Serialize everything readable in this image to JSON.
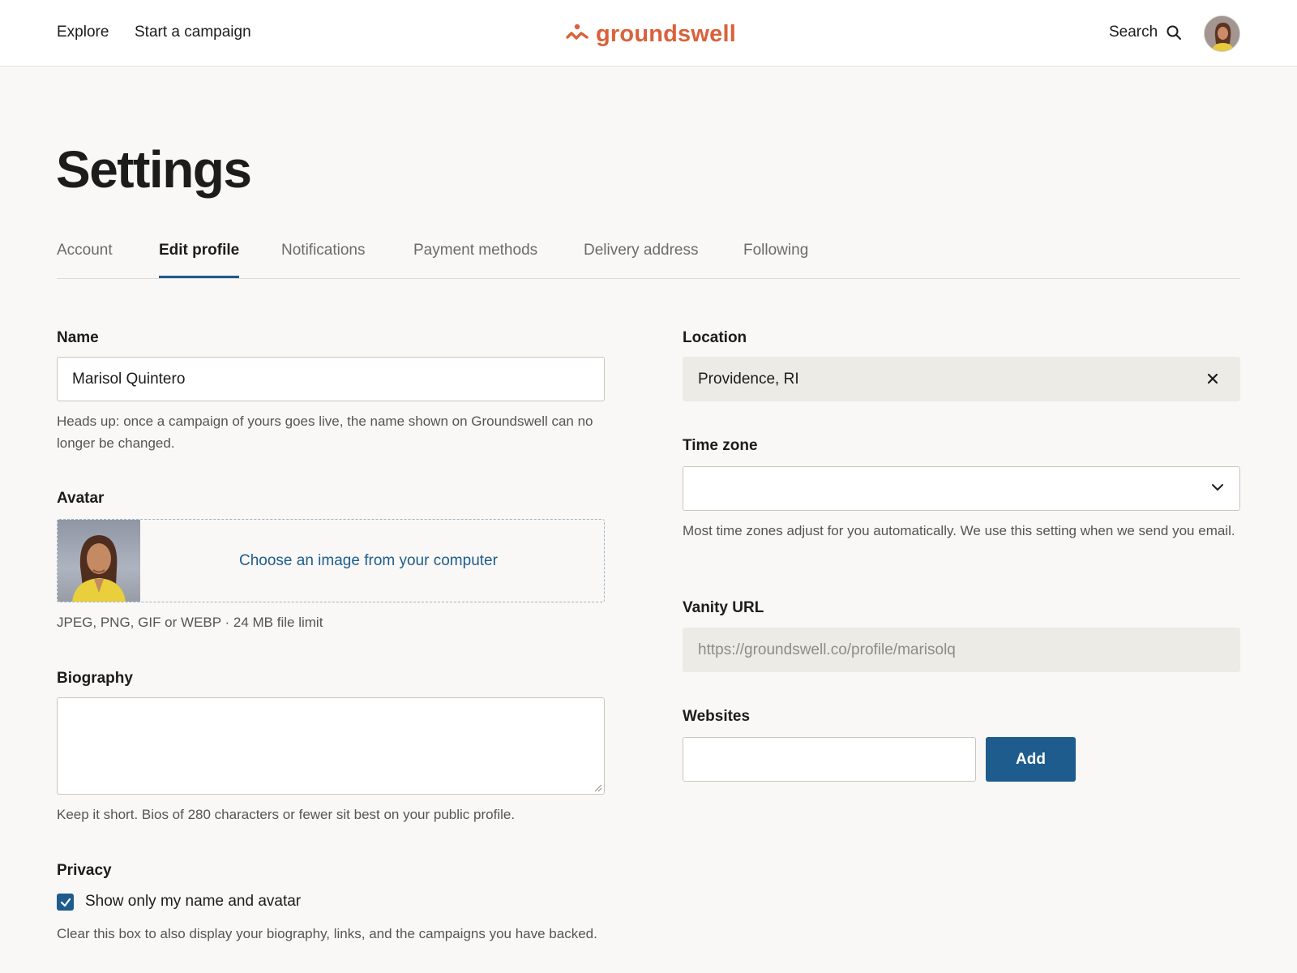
{
  "header": {
    "nav": [
      {
        "label": "Explore"
      },
      {
        "label": "Start a campaign"
      }
    ],
    "logo_text": "groundswell",
    "search_label": "Search",
    "brand_color": "#d9623b"
  },
  "page": {
    "title": "Settings"
  },
  "tabs": [
    {
      "label": "Account",
      "active": false
    },
    {
      "label": "Edit profile",
      "active": true
    },
    {
      "label": "Notifications",
      "active": false
    },
    {
      "label": "Payment methods",
      "active": false
    },
    {
      "label": "Delivery address",
      "active": false
    },
    {
      "label": "Following",
      "active": false
    }
  ],
  "form": {
    "name": {
      "label": "Name",
      "value": "Marisol Quintero",
      "help": "Heads up: once a campaign of yours goes live, the name shown on Groundswell can no longer be changed."
    },
    "avatar": {
      "label": "Avatar",
      "choose_label": "Choose an image from your computer",
      "help": "JPEG, PNG, GIF or WEBP · 24 MB file limit"
    },
    "biography": {
      "label": "Biography",
      "value": "",
      "help": "Keep it short. Bios of 280 characters or fewer sit best on your public profile."
    },
    "privacy": {
      "label": "Privacy",
      "checkbox_label": "Show only my name and avatar",
      "checked": true,
      "help": "Clear this box to also display your biography, links, and the campaigns you have backed."
    },
    "location": {
      "label": "Location",
      "value": "Providence, RI"
    },
    "time_zone": {
      "label": "Time zone",
      "value": "",
      "help": "Most time zones adjust for you automatically. We use this setting when we send you email."
    },
    "vanity_url": {
      "label": "Vanity URL",
      "placeholder": "https://groundswell.co/profile/marisolq"
    },
    "websites": {
      "label": "Websites",
      "value": "",
      "add_label": "Add"
    }
  },
  "colors": {
    "accent": "#1d5c8d",
    "background": "#f9f8f6"
  },
  "icons": [
    "wave-logo-icon",
    "search-icon",
    "close-icon",
    "chevron-down-icon",
    "checkmark-icon"
  ]
}
